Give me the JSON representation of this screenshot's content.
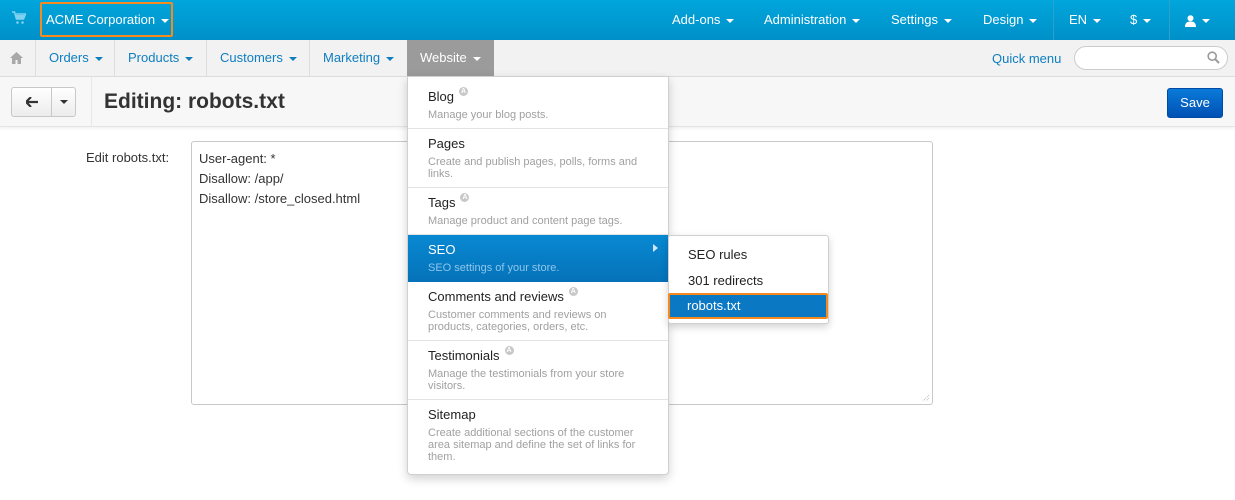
{
  "topbar": {
    "company": "ACME Corporation",
    "menus": [
      "Add-ons",
      "Administration",
      "Settings",
      "Design"
    ],
    "language": "EN",
    "currency": "$"
  },
  "navbar": {
    "items": [
      "Orders",
      "Products",
      "Customers",
      "Marketing",
      "Website"
    ],
    "active": "Website",
    "quick_menu": "Quick menu",
    "search_placeholder": ""
  },
  "page": {
    "title": "Editing: robots.txt",
    "save_label": "Save",
    "field_label": "Edit robots.txt:",
    "field_value": "User-agent: *\nDisallow: /app/\nDisallow: /store_closed.html"
  },
  "website_menu": {
    "items": [
      {
        "title": "Blog",
        "desc": "Manage your blog posts.",
        "badge": "A"
      },
      {
        "title": "Pages",
        "desc": "Create and publish pages, polls, forms and links.",
        "badge": ""
      },
      {
        "title": "Tags",
        "desc": "Manage product and content page tags.",
        "badge": "A"
      },
      {
        "title": "SEO",
        "desc": "SEO settings of your store.",
        "badge": ""
      },
      {
        "title": "Comments and reviews",
        "desc": "Customer comments and reviews on products, categories, orders, etc.",
        "badge": "A"
      },
      {
        "title": "Testimonials",
        "desc": "Manage the testimonials from your store visitors.",
        "badge": "A"
      },
      {
        "title": "Sitemap",
        "desc": "Create additional sections of the customer area sitemap and define the set of links for them.",
        "badge": ""
      }
    ],
    "highlighted": "SEO"
  },
  "seo_submenu": {
    "items": [
      "SEO rules",
      "301 redirects",
      "robots.txt"
    ],
    "selected": "robots.txt"
  },
  "colors": {
    "topbar": "#0099d0",
    "accent_link": "#0e7ec0",
    "highlight_outline": "#f58a1f",
    "save_button": "#0a6ccb"
  }
}
